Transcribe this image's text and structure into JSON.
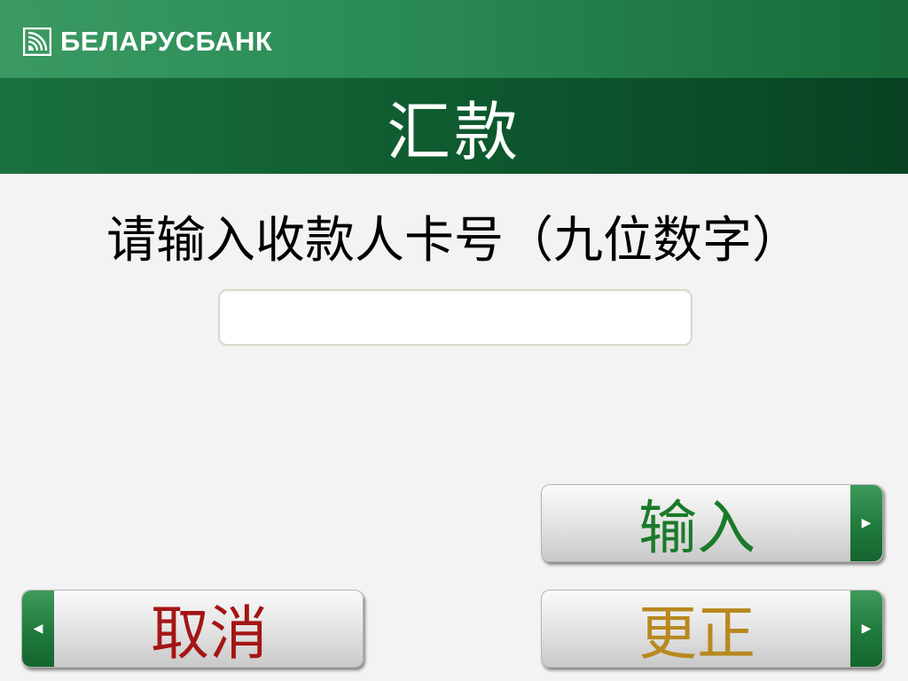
{
  "header": {
    "bank_name": "БЕЛАРУСБАНК",
    "logo_icon": "belarusbank-logo-icon"
  },
  "title": "汇款",
  "prompt": "请输入收款人卡号（九位数字）",
  "card_number_input": {
    "value": "",
    "placeholder": ""
  },
  "buttons": {
    "enter": {
      "label": "输入",
      "icon": "chevron-right-icon"
    },
    "correct": {
      "label": "更正",
      "icon": "chevron-right-icon"
    },
    "cancel": {
      "label": "取消",
      "icon": "chevron-left-icon"
    }
  },
  "colors": {
    "brand_green": "#166b38",
    "enter_text": "#1b7a2a",
    "correct_text": "#b8891f",
    "cancel_text": "#a51515"
  }
}
